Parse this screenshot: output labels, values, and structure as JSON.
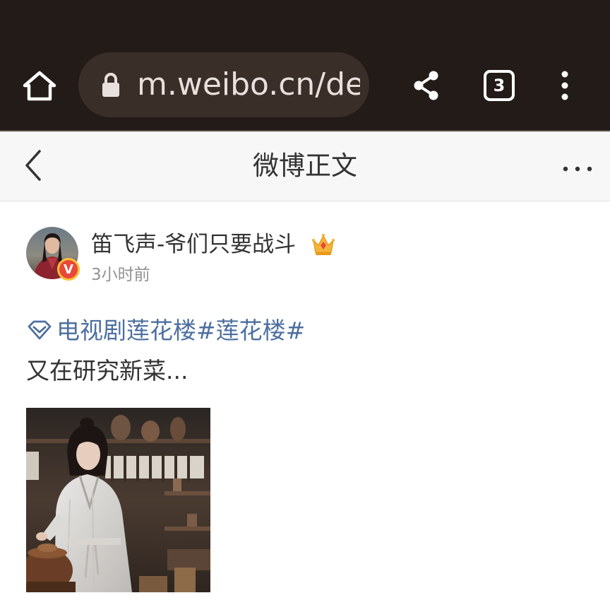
{
  "browser": {
    "url": "m.weibo.cn/de",
    "tab_count": "3",
    "icons": {
      "home": "home-icon",
      "lock": "lock-icon",
      "share": "share-icon",
      "tabs": "tabs-icon",
      "menu": "kebab-menu-icon"
    },
    "colors": {
      "toolbar": "#231b18",
      "url_bar": "#3a2e29"
    }
  },
  "header": {
    "title": "微博正文",
    "back_icon": "chevron-left-icon",
    "more_icon": "ellipsis-icon"
  },
  "post": {
    "username": "笛飞声-爷们只要战斗",
    "verified_badge": "V",
    "member_icon": "crown-icon",
    "timestamp": "3小时前",
    "topic_icon": "diamond-icon",
    "topic_text": "电视剧莲花楼#莲花楼#",
    "text": "又在研究新菜...",
    "image_count": 1
  },
  "colors": {
    "link": "#4d6f9f",
    "text": "#333333",
    "muted": "#939393",
    "verified": "#e8473a"
  }
}
